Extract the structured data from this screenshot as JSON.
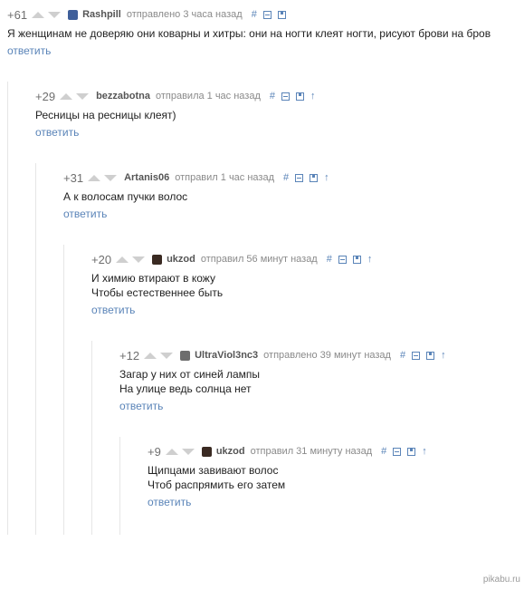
{
  "colors": {
    "link": "#5a84b8",
    "vote_arrow": "#cfcfcf",
    "thread_line": "#e6e6e6"
  },
  "icons": {
    "link": "hash-icon",
    "collapse": "collapse-icon",
    "save": "save-icon",
    "parent": "arrow-up-icon"
  },
  "comments": [
    {
      "rating": "+61",
      "user": "Rashpill",
      "avatar_color": "#3f5f9a",
      "time": "отправлено 3 часа назад",
      "lines": [
        "Я женщинам не доверяю они коварны и хитры: они на ногти клеят ногти, рисуют брови на бров"
      ],
      "reply": "ответить",
      "has_parent_arrow": false
    },
    {
      "rating": "+29",
      "user": "bezzabotna",
      "avatar_color": "",
      "time": "отправила 1 час назад",
      "lines": [
        "Ресницы на ресницы клеят)"
      ],
      "reply": "ответить",
      "has_parent_arrow": true
    },
    {
      "rating": "+31",
      "user": "Artanis06",
      "avatar_color": "",
      "time": "отправил 1 час назад",
      "lines": [
        "А к волосам пучки волос"
      ],
      "reply": "ответить",
      "has_parent_arrow": true
    },
    {
      "rating": "+20",
      "user": "ukzod",
      "avatar_color": "#3a2a22",
      "time": "отправил 56 минут назад",
      "lines": [
        "И химию втирают в кожу",
        "Чтобы естественнее быть"
      ],
      "reply": "ответить",
      "has_parent_arrow": true
    },
    {
      "rating": "+12",
      "user": "UltraViol3nc3",
      "avatar_color": "#6d6d6d",
      "time": "отправлено 39 минут назад",
      "lines": [
        "Загар у них от синей лампы",
        "На улице ведь солнца нет"
      ],
      "reply": "ответить",
      "has_parent_arrow": true
    },
    {
      "rating": "+9",
      "user": "ukzod",
      "avatar_color": "#3a2a22",
      "time": "отправил 31 минуту назад",
      "lines": [
        "Щипцами завивают волос",
        "Чтоб распрямить его затем"
      ],
      "reply": "ответить",
      "has_parent_arrow": true
    }
  ],
  "watermark": "pikabu.ru"
}
